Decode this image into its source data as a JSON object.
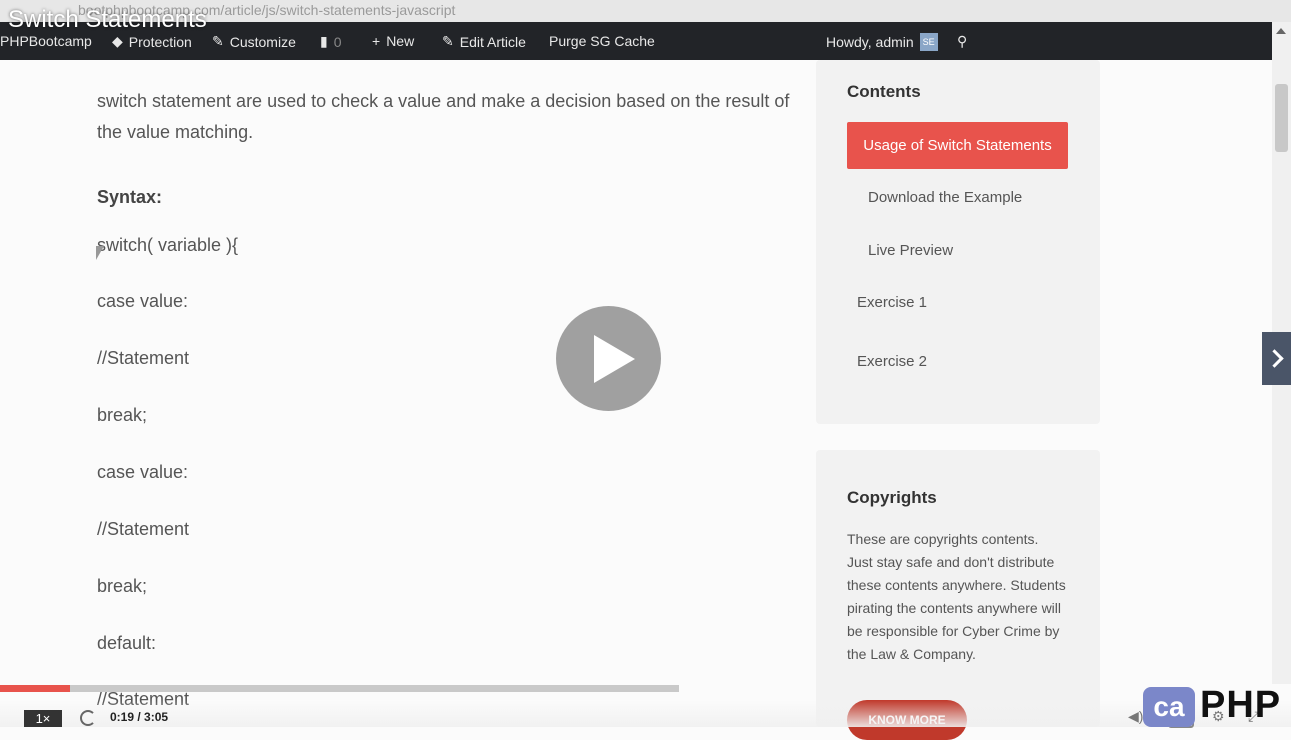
{
  "browser": {
    "url": "bootphpbootcamp.com/article/js/switch-statements-javascript"
  },
  "video": {
    "title": "Switch Statements",
    "speed": "1×",
    "time": "0:19 / 3:05",
    "progress": 0.103,
    "cc_label": "CC"
  },
  "admin_bar": {
    "site": "PHPBootcamp",
    "protection": "Protection",
    "customize": "Customize",
    "comments_count": "0",
    "new": "New",
    "edit_article": "Edit Article",
    "purge": "Purge SG Cache",
    "greeting": "Howdy, admin",
    "avatar_initials": "SE"
  },
  "article": {
    "intro": "switch statement are used to check a value and make a decision based on the result of the value matching.",
    "syntax_label": "Syntax:",
    "code_lines": [
      "switch( variable ){",
      "case value:",
      "//Statement",
      "break;",
      "case value:",
      "//Statement",
      "break;",
      "default:",
      "//Statement"
    ]
  },
  "toc": {
    "title": "Contents",
    "active": "Usage of Switch Statements",
    "items": [
      "Download the Example",
      "Live Preview",
      "Exercise 1",
      "Exercise 2"
    ]
  },
  "copyrights": {
    "title": "Copyrights",
    "text": "These are copyrights contents. Just stay safe and don't distribute these contents anywhere. Students pirating the contents anywhere will be responsible for Cyber Crime by the Law & Company.",
    "button": "KNOW MORE"
  },
  "logo": {
    "box": "ca",
    "text": "PHP"
  },
  "colors": {
    "accent": "#e8534c",
    "admin_bar": "#222428"
  }
}
